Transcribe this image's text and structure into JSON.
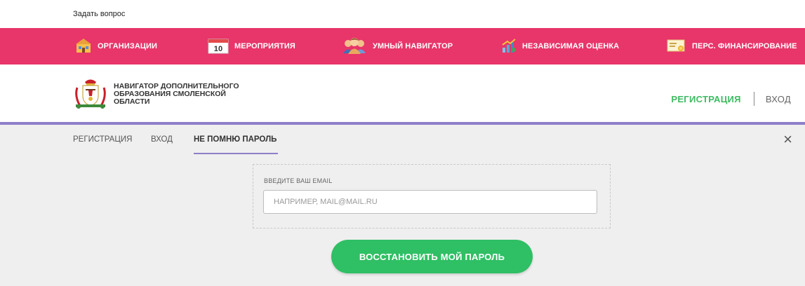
{
  "topbar": {
    "ask_link": "Задать вопрос"
  },
  "nav": {
    "items": [
      {
        "label": "ОРГАНИЗАЦИИ",
        "icon": "building-icon"
      },
      {
        "label": "МЕРОПРИЯТИЯ",
        "icon": "calendar-icon",
        "calendar_day": "10"
      },
      {
        "label": "УМНЫЙ НАВИГАТОР",
        "icon": "people-icon"
      },
      {
        "label": "НЕЗАВИСИМАЯ ОЦЕНКА",
        "icon": "chart-icon"
      },
      {
        "label": "ПЕРС. ФИНАНСИРОВАНИЕ",
        "icon": "certificate-icon"
      }
    ]
  },
  "header": {
    "site_title": "НАВИГАТОР ДОПОЛНИТЕЛЬНОГО ОБРАЗОВАНИЯ СМОЛЕНСКОЙ ОБЛАСТИ",
    "register_link": "РЕГИСТРАЦИЯ",
    "login_link": "ВХОД"
  },
  "modal": {
    "tabs": [
      {
        "label": "РЕГИСТРАЦИЯ",
        "active": false
      },
      {
        "label": "ВХОД",
        "active": false
      },
      {
        "label": "НЕ ПОМНЮ ПАРОЛЬ",
        "active": true
      }
    ],
    "close_icon": "×",
    "email_label": "ВВЕДИТЕ ВАШ EMAIL",
    "email_placeholder": "НАПРИМЕР, MAIL@MAIL.RU",
    "email_value": "",
    "submit_label": "ВОССТАНОВИТЬ МОЙ ПАРОЛЬ"
  },
  "colors": {
    "nav_bg": "#e8356a",
    "accent_green": "#2fbf64",
    "accent_purple": "#8e7ec8"
  }
}
